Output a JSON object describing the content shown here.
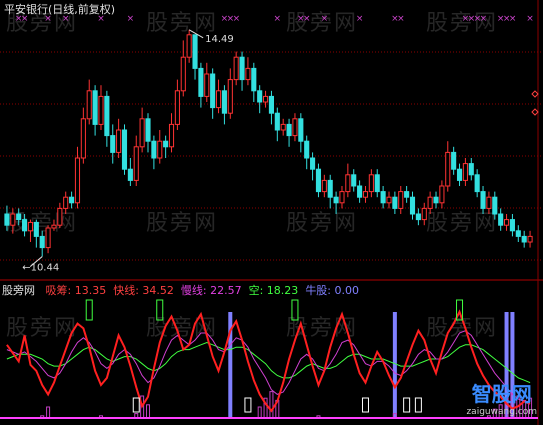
{
  "title": "平安银行(日线,前复权)",
  "price_panel": {
    "high_label": "14.49",
    "low_label": "10.44"
  },
  "indicator_header": {
    "name": "股旁网",
    "items": [
      {
        "label": "吸筹:",
        "value": "13.35",
        "color": "#ff4040"
      },
      {
        "label": "快线:",
        "value": "34.52",
        "color": "#ff4040"
      },
      {
        "label": "慢线:",
        "value": "22.57",
        "color": "#e040e0"
      },
      {
        "label": "空:",
        "value": "18.23",
        "color": "#40ff40"
      },
      {
        "label": "牛股:",
        "value": "0.00",
        "color": "#8080ff"
      }
    ]
  },
  "watermarks": [
    "股旁网",
    "股旁网",
    "股旁网",
    "股旁网",
    "股旁网",
    "股旁网",
    "股旁网",
    "股旁网",
    "股旁网",
    "股旁网",
    "股旁网",
    "股旁网"
  ],
  "logo": {
    "main": "智股网",
    "sub": "zaiguwang.com"
  },
  "colors": {
    "up": "#ff3333",
    "down": "#33e0e0",
    "grid": "#8b0000",
    "fast": "#ff2020",
    "slow": "#d040d0",
    "empty": "#40ff40",
    "bull": "#8080ff",
    "marker_x": "#cc44cc"
  },
  "chart_data": {
    "type": "candlestick",
    "price": {
      "ylim": [
        10.2,
        14.7
      ],
      "high_value": 14.49,
      "low_value": 10.44,
      "candles": [
        [
          11.2,
          11.0,
          11.35,
          10.9
        ],
        [
          11.0,
          11.2,
          11.3,
          10.85
        ],
        [
          11.2,
          11.1,
          11.3,
          11.0
        ],
        [
          11.1,
          10.9,
          11.2,
          10.8
        ],
        [
          10.9,
          11.05,
          11.1,
          10.7
        ],
        [
          11.05,
          10.8,
          11.1,
          10.6
        ],
        [
          10.8,
          10.6,
          10.9,
          10.44
        ],
        [
          10.6,
          10.95,
          11.0,
          10.5
        ],
        [
          10.95,
          11.0,
          11.1,
          10.9
        ],
        [
          11.0,
          11.3,
          11.4,
          10.95
        ],
        [
          11.3,
          11.5,
          11.6,
          11.2
        ],
        [
          11.5,
          11.4,
          11.6,
          11.3
        ],
        [
          11.4,
          12.2,
          12.4,
          11.3
        ],
        [
          12.2,
          12.9,
          13.1,
          12.1
        ],
        [
          12.9,
          13.4,
          13.6,
          12.8
        ],
        [
          13.4,
          12.8,
          13.5,
          12.6
        ],
        [
          12.8,
          13.3,
          13.5,
          12.7
        ],
        [
          13.3,
          12.6,
          13.4,
          12.4
        ],
        [
          12.6,
          12.3,
          12.8,
          12.1
        ],
        [
          12.3,
          12.7,
          12.9,
          12.2
        ],
        [
          12.7,
          12.0,
          12.8,
          11.9
        ],
        [
          12.0,
          11.8,
          12.2,
          11.7
        ],
        [
          11.8,
          12.4,
          12.6,
          11.7
        ],
        [
          12.4,
          12.9,
          13.1,
          12.3
        ],
        [
          12.9,
          12.5,
          13.0,
          12.3
        ],
        [
          12.5,
          12.2,
          12.6,
          12.0
        ],
        [
          12.2,
          12.5,
          12.7,
          12.1
        ],
        [
          12.5,
          12.4,
          12.6,
          12.2
        ],
        [
          12.4,
          12.8,
          13.0,
          12.3
        ],
        [
          12.8,
          13.4,
          13.6,
          12.7
        ],
        [
          13.4,
          14.0,
          14.3,
          13.3
        ],
        [
          14.0,
          14.4,
          14.49,
          13.9
        ],
        [
          14.4,
          13.8,
          14.4,
          13.6
        ],
        [
          13.8,
          13.3,
          13.9,
          13.1
        ],
        [
          13.3,
          13.7,
          13.9,
          13.2
        ],
        [
          13.7,
          13.1,
          13.8,
          12.9
        ],
        [
          13.1,
          13.4,
          13.6,
          13.0
        ],
        [
          13.4,
          13.0,
          13.5,
          12.8
        ],
        [
          13.0,
          13.6,
          13.8,
          12.9
        ],
        [
          13.6,
          14.0,
          14.1,
          13.5
        ],
        [
          14.0,
          13.6,
          14.1,
          13.4
        ],
        [
          13.6,
          13.8,
          14.0,
          13.5
        ],
        [
          13.8,
          13.4,
          13.9,
          13.2
        ],
        [
          13.4,
          13.2,
          13.5,
          13.0
        ],
        [
          13.2,
          13.3,
          13.4,
          13.1
        ],
        [
          13.3,
          13.0,
          13.4,
          12.8
        ],
        [
          13.0,
          12.7,
          13.1,
          12.5
        ],
        [
          12.7,
          12.8,
          12.9,
          12.6
        ],
        [
          12.8,
          12.6,
          12.9,
          12.4
        ],
        [
          12.6,
          12.9,
          13.0,
          12.5
        ],
        [
          12.9,
          12.5,
          13.0,
          12.3
        ],
        [
          12.5,
          12.2,
          12.6,
          12.0
        ],
        [
          12.2,
          12.0,
          12.3,
          11.8
        ],
        [
          12.0,
          11.6,
          12.1,
          11.5
        ],
        [
          11.6,
          11.8,
          11.9,
          11.5
        ],
        [
          11.8,
          11.5,
          11.9,
          11.3
        ],
        [
          11.5,
          11.4,
          11.6,
          11.2
        ],
        [
          11.4,
          11.6,
          11.7,
          11.3
        ],
        [
          11.6,
          11.9,
          12.1,
          11.5
        ],
        [
          11.9,
          11.7,
          12.0,
          11.6
        ],
        [
          11.7,
          11.5,
          11.8,
          11.4
        ],
        [
          11.5,
          11.6,
          11.7,
          11.4
        ],
        [
          11.6,
          11.9,
          12.0,
          11.5
        ],
        [
          11.9,
          11.6,
          12.0,
          11.5
        ],
        [
          11.6,
          11.4,
          11.7,
          11.3
        ],
        [
          11.4,
          11.5,
          11.6,
          11.3
        ],
        [
          11.5,
          11.3,
          11.6,
          11.2
        ],
        [
          11.3,
          11.6,
          11.7,
          11.2
        ],
        [
          11.6,
          11.5,
          11.7,
          11.4
        ],
        [
          11.5,
          11.2,
          11.6,
          11.1
        ],
        [
          11.2,
          11.1,
          11.3,
          11.0
        ],
        [
          11.1,
          11.3,
          11.4,
          11.0
        ],
        [
          11.3,
          11.5,
          11.6,
          11.2
        ],
        [
          11.5,
          11.4,
          11.6,
          11.3
        ],
        [
          11.4,
          11.7,
          11.8,
          11.3
        ],
        [
          11.7,
          12.3,
          12.5,
          11.6
        ],
        [
          12.3,
          12.0,
          12.4,
          11.9
        ],
        [
          12.0,
          11.8,
          12.1,
          11.7
        ],
        [
          11.8,
          12.1,
          12.2,
          11.7
        ],
        [
          12.1,
          11.9,
          12.2,
          11.8
        ],
        [
          11.9,
          11.6,
          12.0,
          11.5
        ],
        [
          11.6,
          11.3,
          11.7,
          11.2
        ],
        [
          11.3,
          11.5,
          11.6,
          11.2
        ],
        [
          11.5,
          11.2,
          11.6,
          11.1
        ],
        [
          11.2,
          11.0,
          11.3,
          10.9
        ],
        [
          11.0,
          11.1,
          11.2,
          10.9
        ],
        [
          11.1,
          10.9,
          11.2,
          10.8
        ],
        [
          10.9,
          10.8,
          11.0,
          10.7
        ],
        [
          10.8,
          10.7,
          10.9,
          10.6
        ],
        [
          10.7,
          10.8,
          10.9,
          10.6
        ]
      ],
      "top_markers": [
        {
          "index": 2,
          "count": 2
        },
        {
          "index": 7,
          "count": 1
        },
        {
          "index": 10,
          "count": 1
        },
        {
          "index": 16,
          "count": 1
        },
        {
          "index": 21,
          "count": 1
        },
        {
          "index": 37,
          "count": 3
        },
        {
          "index": 46,
          "count": 1
        },
        {
          "index": 50,
          "count": 2
        },
        {
          "index": 54,
          "count": 1
        },
        {
          "index": 60,
          "count": 1
        },
        {
          "index": 66,
          "count": 2
        },
        {
          "index": 78,
          "count": 4
        },
        {
          "index": 84,
          "count": 3
        },
        {
          "index": 89,
          "count": 1
        }
      ]
    },
    "indicator": {
      "ylim": [
        0,
        100
      ],
      "fast": [
        62,
        55,
        48,
        70,
        45,
        40,
        28,
        20,
        30,
        44,
        58,
        72,
        80,
        76,
        60,
        40,
        28,
        34,
        52,
        70,
        60,
        44,
        26,
        10,
        18,
        42,
        64,
        78,
        86,
        74,
        58,
        62,
        80,
        88,
        70,
        52,
        40,
        56,
        74,
        82,
        66,
        48,
        32,
        20,
        12,
        6,
        14,
        30,
        50,
        66,
        80,
        62,
        44,
        28,
        40,
        60,
        76,
        88,
        72,
        54,
        38,
        30,
        44,
        56,
        48,
        36,
        26,
        34,
        48,
        62,
        74,
        66,
        50,
        38,
        56,
        72,
        80,
        90,
        76,
        60,
        46,
        36,
        28,
        22,
        18,
        12,
        8,
        10,
        14,
        12
      ],
      "slow": [
        58,
        56,
        54,
        56,
        52,
        48,
        42,
        36,
        34,
        38,
        46,
        56,
        64,
        68,
        64,
        56,
        46,
        42,
        46,
        54,
        58,
        54,
        46,
        36,
        30,
        34,
        44,
        56,
        66,
        70,
        66,
        62,
        66,
        72,
        72,
        66,
        58,
        56,
        62,
        68,
        66,
        60,
        50,
        42,
        34,
        24,
        20,
        22,
        30,
        40,
        50,
        54,
        50,
        42,
        40,
        46,
        54,
        64,
        66,
        62,
        54,
        46,
        44,
        48,
        48,
        44,
        38,
        36,
        40,
        46,
        54,
        58,
        56,
        50,
        50,
        56,
        64,
        72,
        74,
        70,
        62,
        54,
        46,
        38,
        32,
        26,
        20,
        16,
        14,
        14
      ],
      "empty": [
        50,
        52,
        54,
        54,
        54,
        52,
        50,
        46,
        44,
        44,
        46,
        50,
        54,
        58,
        60,
        58,
        54,
        50,
        48,
        50,
        52,
        52,
        50,
        46,
        42,
        40,
        42,
        46,
        52,
        56,
        58,
        58,
        60,
        62,
        64,
        62,
        60,
        58,
        58,
        60,
        60,
        58,
        54,
        50,
        46,
        40,
        36,
        34,
        34,
        36,
        40,
        44,
        46,
        44,
        42,
        42,
        44,
        48,
        52,
        54,
        54,
        52,
        50,
        50,
        50,
        48,
        46,
        44,
        44,
        44,
        46,
        48,
        50,
        50,
        50,
        52,
        56,
        60,
        62,
        62,
        60,
        58,
        54,
        50,
        46,
        42,
        38,
        34,
        32,
        30
      ],
      "bull_bars": [
        38,
        66,
        85,
        86
      ],
      "green_boxes": [
        14,
        26,
        49,
        77
      ],
      "white_boxes": [
        22,
        41,
        61,
        68,
        70
      ]
    }
  }
}
